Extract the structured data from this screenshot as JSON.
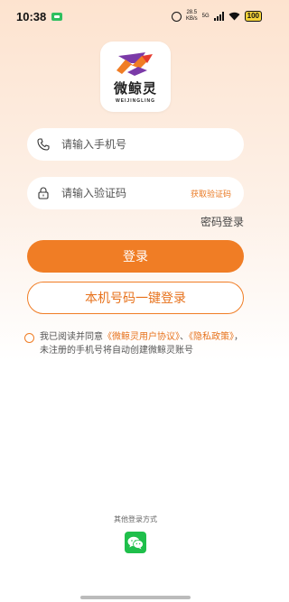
{
  "status_bar": {
    "time": "10:38",
    "speed_value": "28.5",
    "speed_unit": "KB/s",
    "network": "5G",
    "battery": "100"
  },
  "logo": {
    "title": "微鲸灵",
    "subtitle": "WEIJINGLING"
  },
  "login_form": {
    "phone_placeholder": "请输入手机号",
    "code_placeholder": "请输入验证码",
    "get_code_label": "获取验证码",
    "password_login_label": "密码登录",
    "login_button": "登录",
    "one_key_login_button": "本机号码一键登录"
  },
  "agreement": {
    "text_before": "我已阅读并同意",
    "user_agreement_link": "《微鲸灵用户协议》",
    "separator": "、",
    "privacy_link": "《隐私政策》",
    "text_after": "，未注册的手机号将自动创建微鲸灵账号"
  },
  "other_login": {
    "label": "其他登录方式",
    "wechat_icon": "wechat-icon"
  },
  "colors": {
    "accent": "#f07d25",
    "wechat": "#1fbf4b"
  }
}
